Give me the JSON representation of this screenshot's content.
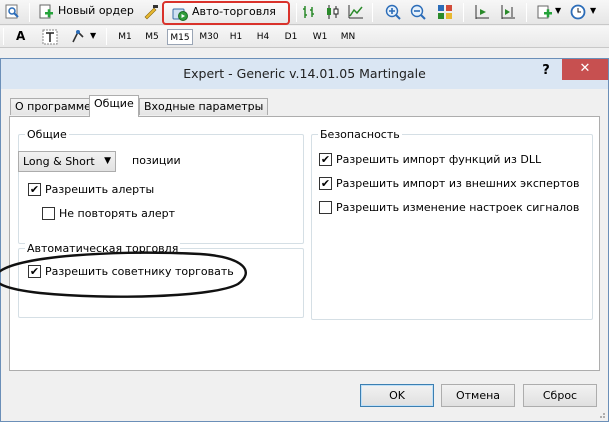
{
  "toolbar": {
    "new_order_label": "Новый ордер",
    "auto_trading_label": "Авто-торговля"
  },
  "timeframes": [
    "M1",
    "M5",
    "M15",
    "M30",
    "H1",
    "H4",
    "D1",
    "W1",
    "MN"
  ],
  "active_timeframe": "M15",
  "dialog": {
    "title": "Expert - Generic v.14.01.05 Martingale",
    "help_label": "?",
    "close_label": "✕",
    "tabs": [
      {
        "label": "О программе",
        "active": false
      },
      {
        "label": "Общие",
        "active": true
      },
      {
        "label": "Входные параметры",
        "active": false
      }
    ],
    "common": {
      "title": "Общие",
      "mode_value": "Long & Short",
      "positions_label": "позиции",
      "allow_alerts": {
        "label": "Разрешить алерты",
        "checked": true
      },
      "no_repeat_alert": {
        "label": "Не повторять алерт",
        "checked": false
      }
    },
    "auto": {
      "title": "Автоматическая торговля",
      "allow_trading": {
        "label": "Разрешить советнику торговать",
        "checked": true
      }
    },
    "security": {
      "title": "Безопасность",
      "allow_dll": {
        "label": "Разрешить импорт функций из DLL",
        "checked": true
      },
      "allow_external": {
        "label": "Разрешить импорт из внешних экспертов",
        "checked": true
      },
      "allow_signal_change": {
        "label": "Разрешить изменение настроек сигналов",
        "checked": false
      }
    },
    "buttons": {
      "ok": "OK",
      "cancel": "Отмена",
      "reset": "Сброс"
    }
  },
  "colors": {
    "highlight_red": "#d9322b",
    "close_red": "#c75050",
    "title_bg": "#dae6f3",
    "annotation": "#000000"
  }
}
